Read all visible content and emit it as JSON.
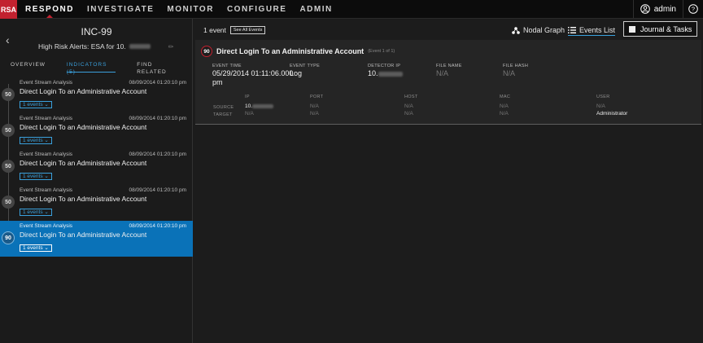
{
  "nav": {
    "logo": "RSA",
    "items": [
      "RESPOND",
      "INVESTIGATE",
      "MONITOR",
      "CONFIGURE",
      "ADMIN"
    ],
    "active": "RESPOND",
    "user": "admin",
    "accent": "#c2212f"
  },
  "incident": {
    "id": "INC-99",
    "name_prefix": "High Risk Alerts: ESA for 10.",
    "tabs": [
      {
        "label": "OVERVIEW",
        "active": false
      },
      {
        "label": "INDICATORS (5)",
        "active": true
      },
      {
        "label": "FIND RELATED",
        "active": false
      }
    ]
  },
  "indicators": [
    {
      "score": "50",
      "source": "Event Stream Analysis",
      "time": "08/09/2014 01:20:10 pm",
      "title": "Direct Login To an Administrative Account",
      "events": "1 events",
      "selected": false
    },
    {
      "score": "50",
      "source": "Event Stream Analysis",
      "time": "08/09/2014 01:20:10 pm",
      "title": "Direct Login To an Administrative Account",
      "events": "1 events",
      "selected": false
    },
    {
      "score": "50",
      "source": "Event Stream Analysis",
      "time": "08/09/2014 01:20:10 pm",
      "title": "Direct Login To an Administrative Account",
      "events": "1 events",
      "selected": false
    },
    {
      "score": "50",
      "source": "Event Stream Analysis",
      "time": "08/09/2014 01:20:10 pm",
      "title": "Direct Login To an Administrative Account",
      "events": "1 events",
      "selected": false
    },
    {
      "score": "90",
      "source": "Event Stream Analysis",
      "time": "08/09/2014 01:20:10 pm",
      "title": "Direct Login To an Administrative Account",
      "events": "1 events",
      "selected": true
    }
  ],
  "events_header": {
    "count": "1 event",
    "see_all": "See All Events",
    "nodal_graph": "Nodal Graph",
    "events_list": "Events List",
    "journal": "Journal & Tasks"
  },
  "event": {
    "score": "90",
    "title": "Direct Login To an Administrative Account",
    "sub": "(Event 1 of 1)",
    "fields": {
      "event_time_label": "EVENT TIME",
      "event_time_value_line1": "05/29/2014 01:11:06.000",
      "event_time_value_line2": "pm",
      "event_type_label": "EVENT TYPE",
      "event_type_value": "Log",
      "detector_ip_label": "DETECTOR IP",
      "detector_ip_value": "10.",
      "file_name_label": "FILE NAME",
      "file_name_value": "N/A",
      "file_hash_label": "FILE HASH",
      "file_hash_value": "N/A"
    },
    "table": {
      "columns": [
        "IP",
        "PORT",
        "HOST",
        "MAC",
        "USER"
      ],
      "rows": [
        {
          "label": "SOURCE",
          "cells": [
            "10.",
            "N/A",
            "N/A",
            "N/A",
            "N/A"
          ]
        },
        {
          "label": "TARGET",
          "cells": [
            "N/A",
            "N/A",
            "N/A",
            "N/A",
            "Administrator"
          ]
        }
      ]
    }
  }
}
